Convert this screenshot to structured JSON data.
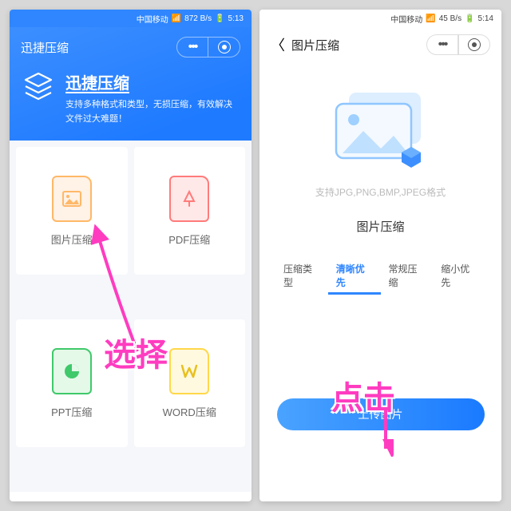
{
  "phone1": {
    "status": {
      "carrier": "中国移动",
      "net": "872 B/s",
      "time": "5:13"
    },
    "title": "迅捷压缩",
    "menu": {
      "more": "•••"
    },
    "hero": {
      "title": "迅捷压缩",
      "sub": "支持多种格式和类型，无损压缩，有效解决文件过大难题！"
    },
    "cards": [
      {
        "label": "图片压缩"
      },
      {
        "label": "PDF压缩"
      },
      {
        "label": "PPT压缩"
      },
      {
        "label": "WORD压缩"
      }
    ]
  },
  "phone2": {
    "status": {
      "carrier": "中国移动",
      "net": "45 B/s",
      "time": "5:14"
    },
    "title": "图片压缩",
    "support": "支持JPG,PNG,BMP,JPEG格式",
    "section_title": "图片压缩",
    "segs": {
      "label": "压缩类型",
      "options": [
        "清晰优先",
        "常规压缩",
        "缩小优先"
      ],
      "active": 0
    },
    "upload": "上传图片"
  },
  "annot": {
    "select": "选择",
    "click": "点击"
  }
}
